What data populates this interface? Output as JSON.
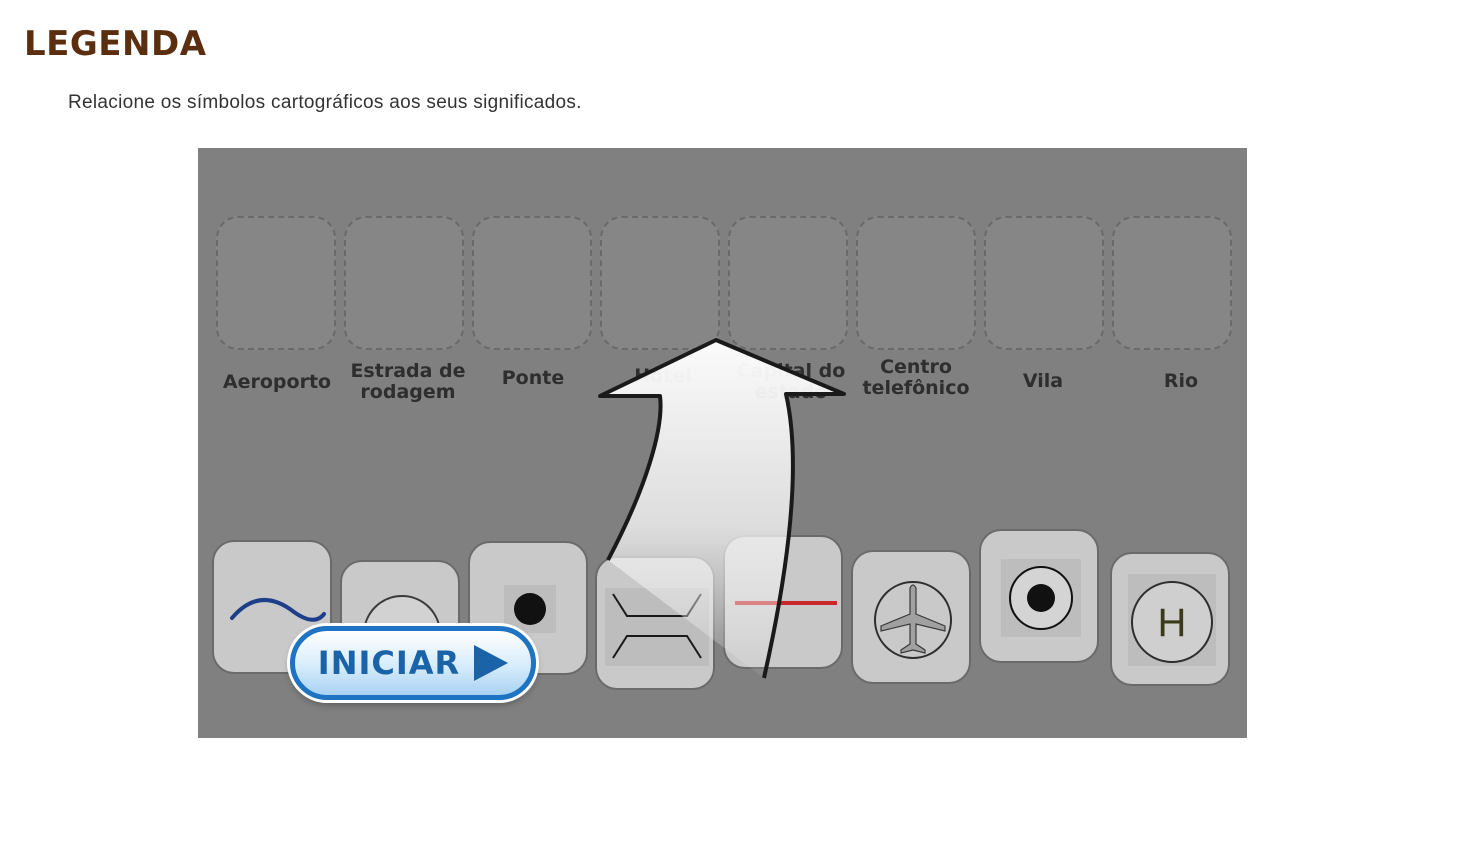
{
  "page": {
    "title": "LEGENDA",
    "instructions": "Relacione os símbolos cartográficos aos seus significados."
  },
  "game": {
    "labels": [
      {
        "line1": "Aeroporto",
        "line2": ""
      },
      {
        "line1": "Estrada de",
        "line2": "rodagem"
      },
      {
        "line1": "Ponte",
        "line2": ""
      },
      {
        "line1": "Hotel",
        "line2": ""
      },
      {
        "line1": "Capital do",
        "line2": "estado"
      },
      {
        "line1": "Centro",
        "line2": "telefônico"
      },
      {
        "line1": "Vila",
        "line2": ""
      },
      {
        "line1": "Rio",
        "line2": ""
      }
    ],
    "cards": [
      {
        "icon": "river-icon"
      },
      {
        "icon": "telephone-icon"
      },
      {
        "icon": "village-icon"
      },
      {
        "icon": "bridge-icon"
      },
      {
        "icon": "road-icon"
      },
      {
        "icon": "airport-icon"
      },
      {
        "icon": "state-capital-icon"
      },
      {
        "icon": "hotel-icon",
        "glyph": "H"
      }
    ],
    "start_button": {
      "label": "INICIAR",
      "icon": "play-icon"
    },
    "colors": {
      "overlay": "#808080",
      "river": "#1d3f8a",
      "road": "#c8282a",
      "button": "#1e73c2",
      "title": "#5a2e0e"
    }
  }
}
